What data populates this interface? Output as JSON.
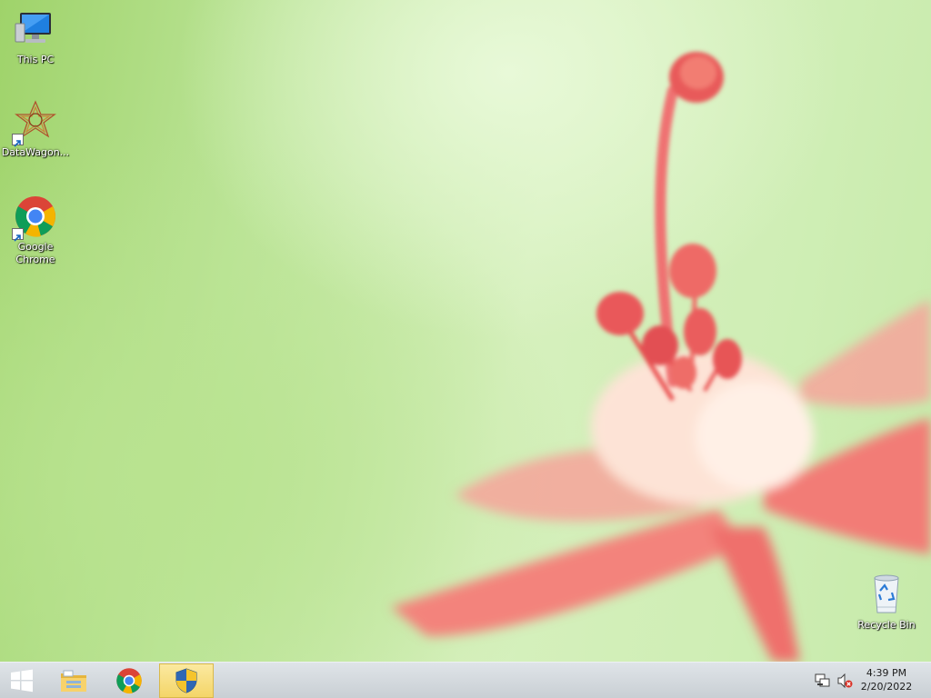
{
  "desktop": {
    "icons": [
      {
        "label": "This PC",
        "icon": "computer-icon"
      },
      {
        "label": "DataWagon...",
        "icon": "datawagon-icon"
      },
      {
        "label": "Google Chrome",
        "icon": "chrome-icon"
      },
      {
        "label": "Recycle Bin",
        "icon": "recycle-bin-icon"
      }
    ]
  },
  "taskbar": {
    "start_icon": "windows-logo-icon",
    "pinned": [
      {
        "name": "File Explorer",
        "icon": "file-explorer-icon",
        "active": false
      },
      {
        "name": "Google Chrome",
        "icon": "chrome-icon",
        "active": false
      },
      {
        "name": "User Account Control",
        "icon": "uac-shield-icon",
        "active": true
      }
    ],
    "tray": {
      "icons": [
        "network-icon",
        "volume-muted-icon"
      ],
      "time": "4:39 PM",
      "date": "2/20/2022"
    }
  },
  "colors": {
    "taskbar": "#d3d8dc",
    "active_button": "#f4d568",
    "wallpaper_green": "#c6eaa9",
    "flower_pink": "#f07d7d"
  }
}
